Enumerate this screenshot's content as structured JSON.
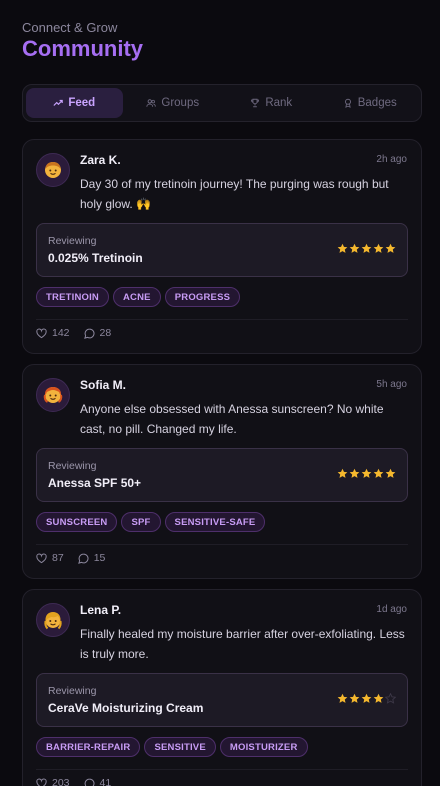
{
  "header": {
    "eyebrow": "Connect & Grow",
    "title": "Community"
  },
  "tabs": [
    {
      "label": "Feed",
      "icon": "trending-icon",
      "active": true
    },
    {
      "label": "Groups",
      "icon": "users-icon",
      "active": false
    },
    {
      "label": "Rank",
      "icon": "trophy-icon",
      "active": false
    },
    {
      "label": "Badges",
      "icon": "award-icon",
      "active": false
    }
  ],
  "posts": [
    {
      "author": "Zara K.",
      "avatar": "avatar-emoji-icon",
      "time": "2h ago",
      "text": "Day 30 of my tretinoin journey! The purging was rough but holy glow. 🙌",
      "review_label": "Reviewing",
      "product": "0.025% Tretinoin",
      "rating": 5,
      "tags": [
        "TRETINOIN",
        "ACNE",
        "PROGRESS"
      ],
      "likes": "142",
      "comments": "28"
    },
    {
      "author": "Sofia M.",
      "avatar": "avatar-emoji-icon",
      "time": "5h ago",
      "text": "Anyone else obsessed with Anessa sunscreen? No white cast, no pill. Changed my life.",
      "review_label": "Reviewing",
      "product": "Anessa SPF 50+",
      "rating": 5,
      "tags": [
        "SUNSCREEN",
        "SPF",
        "SENSITIVE-SAFE"
      ],
      "likes": "87",
      "comments": "15"
    },
    {
      "author": "Lena P.",
      "avatar": "avatar-emoji-icon",
      "time": "1d ago",
      "text": "Finally healed my moisture barrier after over-exfoliating. Less is truly more.",
      "review_label": "Reviewing",
      "product": "CeraVe Moisturizing Cream",
      "rating": 4,
      "tags": [
        "BARRIER-REPAIR",
        "SENSITIVE",
        "MOISTURIZER"
      ],
      "likes": "203",
      "comments": "41"
    }
  ],
  "colors": {
    "accent": "#a66ef2",
    "star": "#f5b82e",
    "star_empty": "#3d3848"
  }
}
